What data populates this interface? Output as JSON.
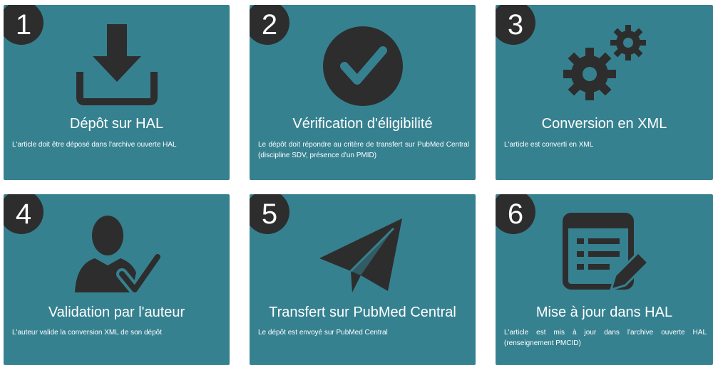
{
  "steps": [
    {
      "number": "1",
      "icon": "download-icon",
      "title": "Dépôt sur HAL",
      "description": "L'article doit être déposé dans l'archive ouverte HAL"
    },
    {
      "number": "2",
      "icon": "check-circle-icon",
      "title": "Vérification d'éligibilité",
      "description": "Le dépôt doit répondre au critère de transfert sur PubMed Central (discipline SDV, présence d'un PMID)"
    },
    {
      "number": "3",
      "icon": "gears-icon",
      "title": "Conversion en XML",
      "description": "L'article est converti en XML"
    },
    {
      "number": "4",
      "icon": "user-check-icon",
      "title": "Validation par l'auteur",
      "description": "L'auteur valide la conversion XML de son dépôt"
    },
    {
      "number": "5",
      "icon": "paper-plane-icon",
      "title": "Transfert sur PubMed Central",
      "description": "Le dépôt est envoyé sur PubMed Central"
    },
    {
      "number": "6",
      "icon": "edit-document-icon",
      "title": "Mise à jour dans HAL",
      "description": "L'article est mis à jour dans l'archive ouverte HAL (renseignement PMCID)"
    }
  ],
  "colors": {
    "card_background": "#368190",
    "badge_background": "#2d2d2d",
    "icon_color": "#2d2d2d",
    "text_color": "#ffffff"
  }
}
